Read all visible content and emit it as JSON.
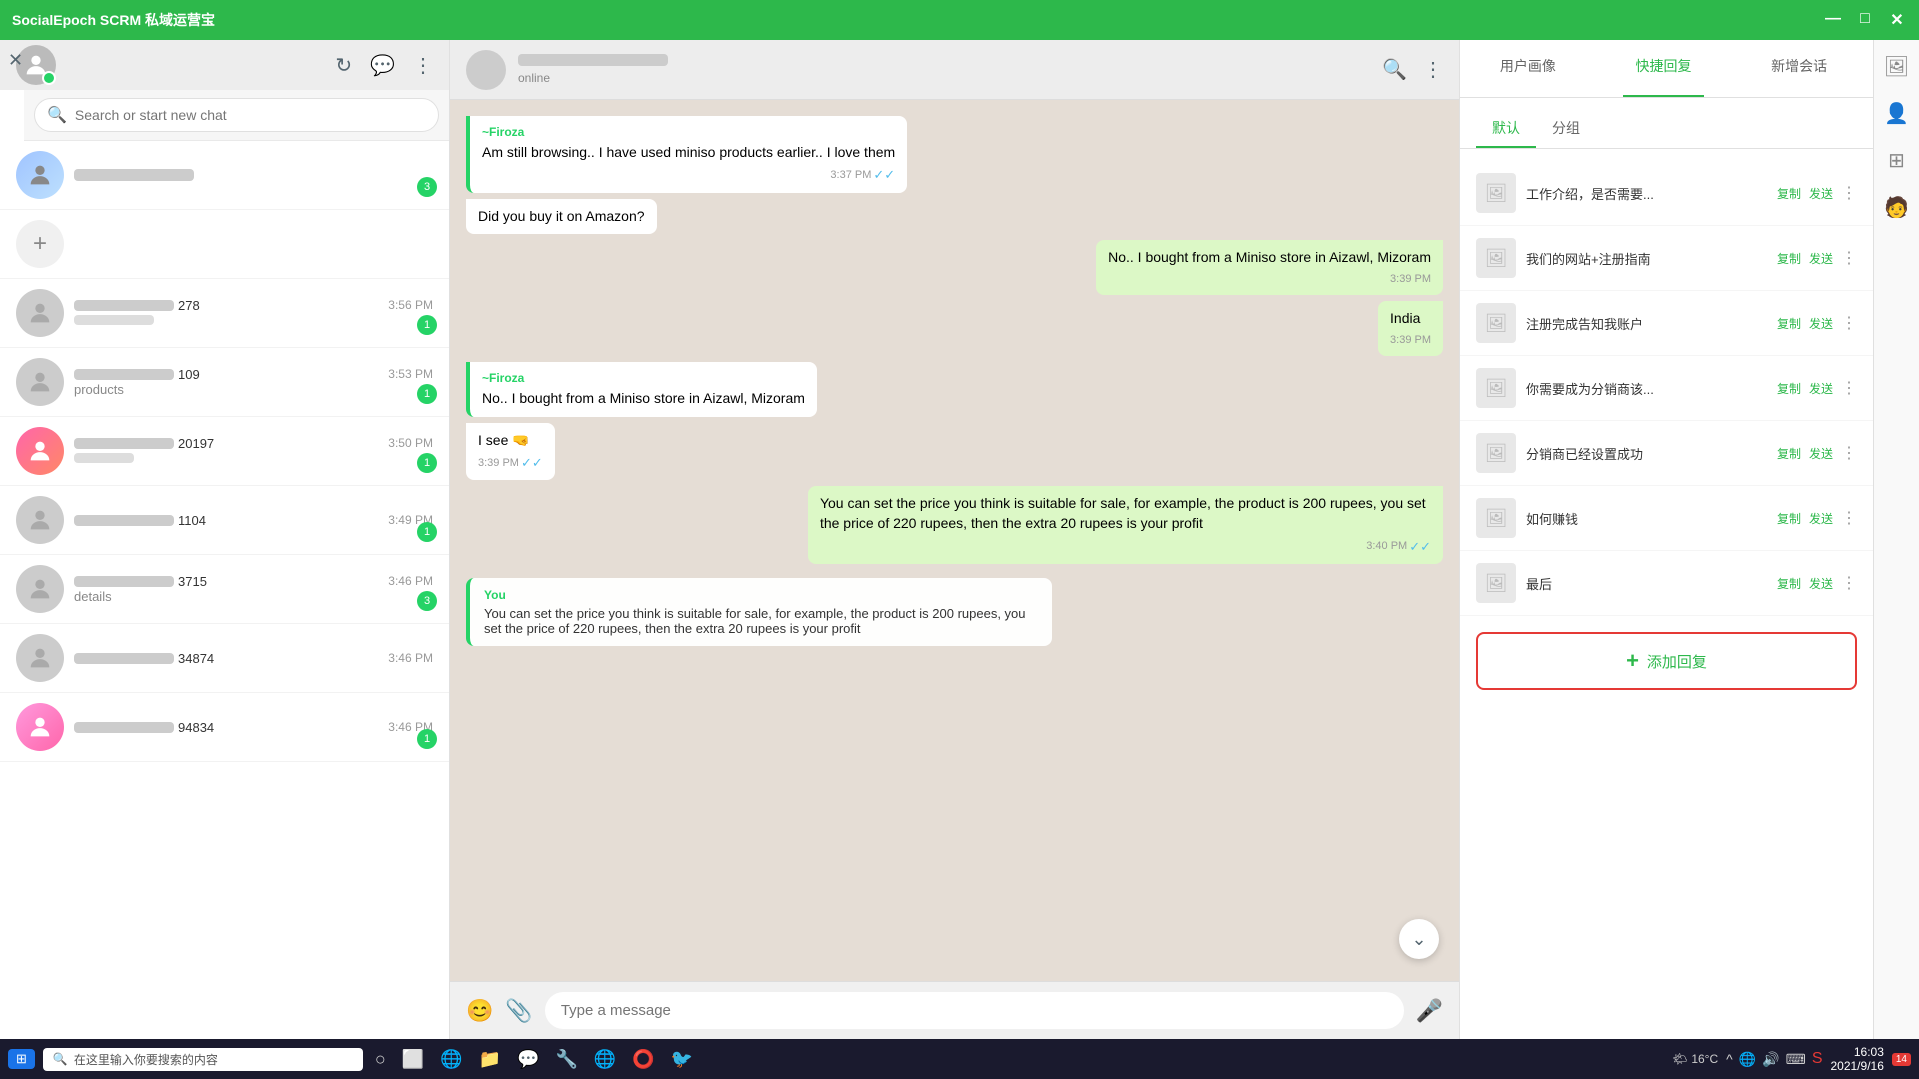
{
  "titlebar": {
    "title": "SocialEpoch SCRM 私域运营宝",
    "controls": [
      "—",
      "□",
      "✕"
    ]
  },
  "sidebar": {
    "search_placeholder": "Search or start new chat",
    "chats": [
      {
        "id": 1,
        "name_suffix": "278",
        "time": "3:56 PM",
        "preview": "",
        "badge": 1,
        "has_avatar": false
      },
      {
        "id": 2,
        "name_suffix": "109",
        "time": "3:53 PM",
        "preview": "products",
        "badge": 1,
        "has_avatar": false
      },
      {
        "id": 3,
        "name_suffix": "20197",
        "time": "3:50 PM",
        "preview": "",
        "badge": 1,
        "has_avatar": true
      },
      {
        "id": 4,
        "name_suffix": "1104",
        "time": "3:49 PM",
        "preview": "",
        "badge": 1,
        "has_avatar": false
      },
      {
        "id": 5,
        "name_suffix": "3715",
        "time": "3:46 PM",
        "preview": "details",
        "badge": 3,
        "has_avatar": false
      },
      {
        "id": 6,
        "name_suffix": "34874",
        "time": "3:46 PM",
        "preview": "",
        "badge": 0,
        "has_avatar": false
      },
      {
        "id": 7,
        "name_suffix": "94834",
        "time": "3:46 PM",
        "preview": "",
        "badge": 1,
        "has_avatar": true
      }
    ]
  },
  "chat_header": {
    "contact_name": "Contact",
    "status": "online"
  },
  "messages": [
    {
      "id": 1,
      "type": "in",
      "sender": "~Firoza",
      "text": "Am still browsing.. I have used miniso products earlier.. I love them",
      "time": "3:37 PM",
      "ticks": "✓✓"
    },
    {
      "id": 2,
      "type": "in",
      "sender": "",
      "text": "Did you buy it on Amazon?",
      "time": "",
      "ticks": ""
    },
    {
      "id": 3,
      "type": "out",
      "sender": "",
      "text": "No.. I bought from a Miniso store in Aizawl, Mizoram",
      "time": "3:39 PM",
      "ticks": ""
    },
    {
      "id": 4,
      "type": "out",
      "sender": "",
      "text": "India",
      "time": "3:39 PM",
      "ticks": ""
    },
    {
      "id": 5,
      "type": "in",
      "sender": "~Firoza",
      "text": "No.. I bought from a Miniso store in Aizawl, Mizoram",
      "time": "",
      "ticks": ""
    },
    {
      "id": 6,
      "type": "in",
      "sender": "",
      "text": "I see 🤜",
      "time": "3:39 PM",
      "ticks": "✓✓"
    },
    {
      "id": 7,
      "type": "out",
      "sender": "",
      "text": "You can set the price you think is suitable for sale, for example, the product is 200 rupees, you set the price of 220 rupees, then the extra 20 rupees is your profit",
      "time": "3:40 PM",
      "ticks": "✓✓"
    }
  ],
  "floating_preview": {
    "sender": "You",
    "text": "You can set the price you think is suitable for sale, for example, the product is 200 rupees, you set the price of 220 rupees, then the extra 20 rupees is your profit"
  },
  "input": {
    "placeholder": "Type a message"
  },
  "right_panel": {
    "tabs": [
      "用户画像",
      "快捷回复",
      "新增会话"
    ],
    "subtabs": [
      "默认",
      "分组"
    ],
    "quick_replies": [
      {
        "id": 1,
        "text": "工作介绍，是否需要..."
      },
      {
        "id": 2,
        "text": "我们的网站+注册指南"
      },
      {
        "id": 3,
        "text": "注册完成告知我账户"
      },
      {
        "id": 4,
        "text": "你需要成为分销商该..."
      },
      {
        "id": 5,
        "text": "分销商已经设置成功"
      },
      {
        "id": 6,
        "text": "如何赚钱"
      },
      {
        "id": 7,
        "text": "最后"
      }
    ],
    "add_btn_label": "添加回复",
    "copy_label": "复制",
    "send_label": "发送"
  },
  "taskbar": {
    "search_placeholder": "在这里输入你要搜索的内容",
    "time": "16:03",
    "date": "2021/9/16",
    "temperature": "16°C",
    "notification_count": "14"
  }
}
